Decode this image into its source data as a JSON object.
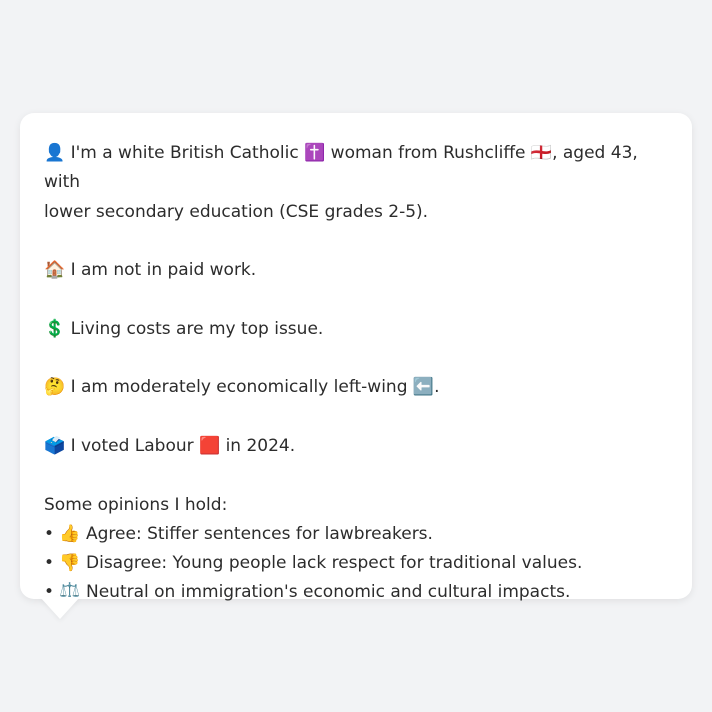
{
  "profile": {
    "intro_line1": "👤 I'm a white British Catholic ✝️ woman from Rushcliffe 🏴󠁧󠁢󠁥󠁮󠁧󠁿, aged 43, with",
    "intro_line2": "lower secondary education (CSE grades 2-5).",
    "work": "🏠 I am not in paid work.",
    "issue": "💲 Living costs are my top issue.",
    "economics": "🤔 I am moderately economically left-wing ⬅️.",
    "vote": "🗳️ I voted Labour 🟥 in 2024."
  },
  "opinions": {
    "heading": "Some opinions I hold:",
    "items": [
      "• 👍 Agree: Stiffer sentences for lawbreakers.",
      "• 👎 Disagree: Young people lack respect for traditional values.",
      "• ⚖️ Neutral on immigration's economic and cultural impacts."
    ]
  }
}
